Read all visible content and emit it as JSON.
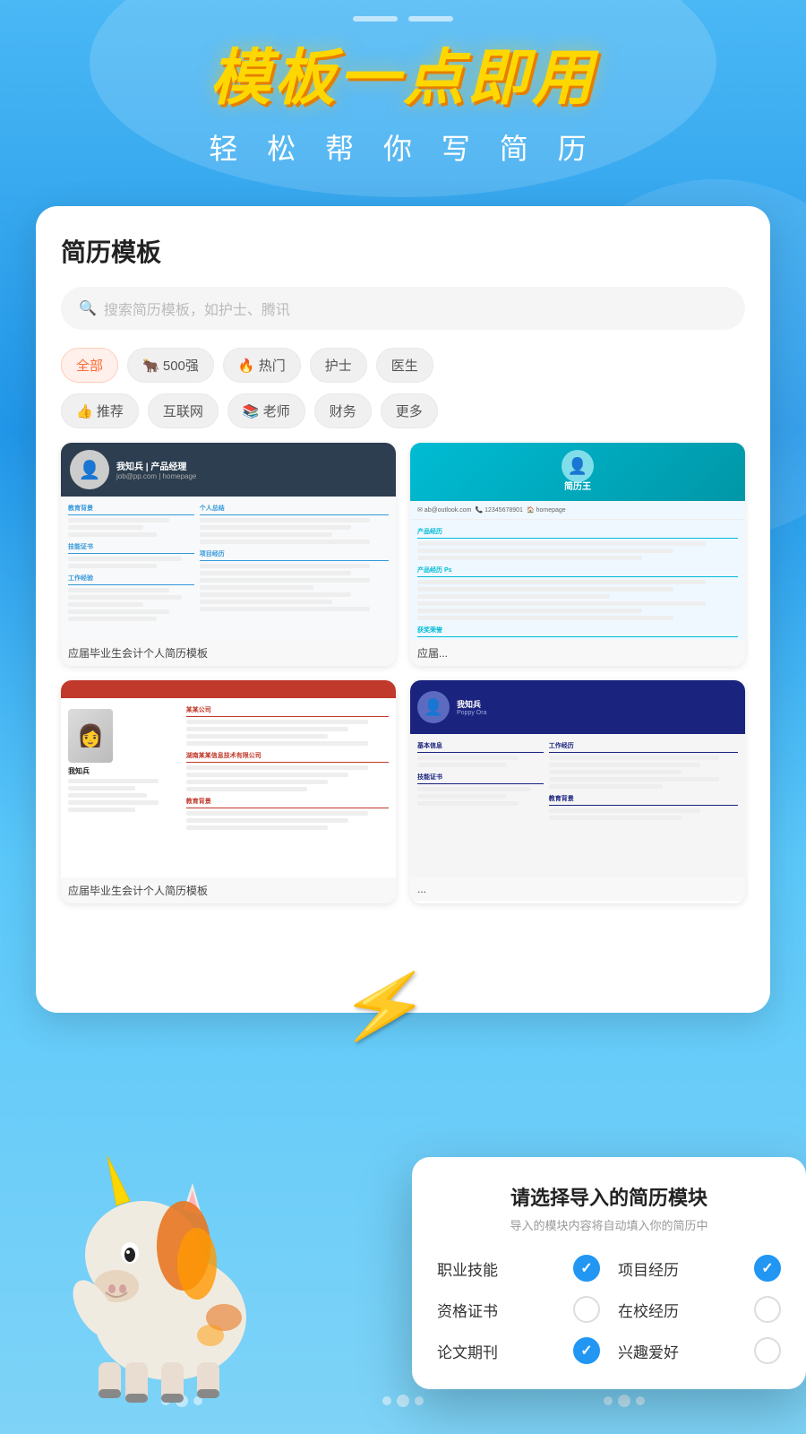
{
  "hero": {
    "title": "模板一点即用",
    "subtitle": "轻 松 帮 你 写 简 历"
  },
  "card": {
    "title": "简历模板",
    "search_placeholder": "搜索简历模板，如护士、腾讯"
  },
  "tags_row1": [
    {
      "label": "全部",
      "active": true
    },
    {
      "label": "🐂 500强",
      "active": false
    },
    {
      "label": "🔥 热门",
      "active": false
    },
    {
      "label": "护士",
      "active": false
    },
    {
      "label": "医生",
      "active": false
    }
  ],
  "tags_row2": [
    {
      "label": "👍 推荐",
      "active": false
    },
    {
      "label": "互联网",
      "active": false
    },
    {
      "label": "📚 老师",
      "active": false
    },
    {
      "label": "财务",
      "active": false
    },
    {
      "label": "更多",
      "active": false
    }
  ],
  "templates": [
    {
      "id": "t1",
      "label": "应届毕业生会计个人简历模板"
    },
    {
      "id": "t2",
      "label": "应届..."
    },
    {
      "id": "t3",
      "label": "应届毕业生会计个人简历模板"
    },
    {
      "id": "t4",
      "label": "..."
    }
  ],
  "dialog": {
    "title": "请选择导入的简历模块",
    "subtitle": "导入的模块内容将自动填入你的简历中",
    "items": [
      {
        "label": "职业技能",
        "checked": true
      },
      {
        "label": "项目经历",
        "checked": true
      },
      {
        "label": "资格证书",
        "checked": false
      },
      {
        "label": "在校经历",
        "checked": false
      },
      {
        "label": "论文期刊",
        "checked": true
      },
      {
        "label": "兴趣爱好",
        "checked": false
      }
    ]
  },
  "top_bars": [
    "",
    ""
  ],
  "colors": {
    "accent_blue": "#2196F3",
    "accent_yellow": "#FFD700",
    "bg_gradient_start": "#4ab8f5",
    "bg_gradient_end": "#2196e8"
  }
}
